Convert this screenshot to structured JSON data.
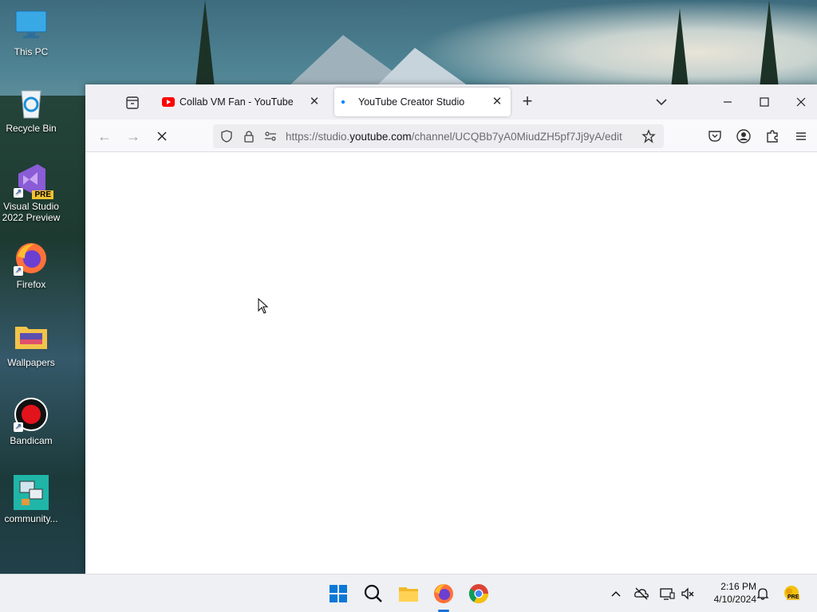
{
  "desktop": {
    "icons": [
      {
        "label": "This PC"
      },
      {
        "label": "Recycle Bin"
      },
      {
        "label": "Visual Studio 2022 Preview",
        "badge": "PRE"
      },
      {
        "label": "Firefox"
      },
      {
        "label": "Wallpapers"
      },
      {
        "label": "Bandicam"
      },
      {
        "label": "community..."
      }
    ]
  },
  "browser": {
    "tabs": [
      {
        "title": "Collab VM Fan - YouTube",
        "active": false,
        "favicon": "youtube-icon"
      },
      {
        "title": "YouTube Creator Studio",
        "active": true,
        "favicon": "loading-dot-icon"
      }
    ],
    "url": {
      "prefix": "https://studio.",
      "domain": "youtube.com",
      "suffix": "/channel/UCQBb7yA0MiudZH5pf7Jj9yA/edit"
    },
    "loading": true
  },
  "taskbar": {
    "apps": [
      "start-icon",
      "search-icon",
      "file-explorer-icon",
      "firefox-icon",
      "chrome-icon"
    ],
    "clock": {
      "time": "2:16 PM",
      "date": "4/10/2024"
    },
    "tray_badge": "PRE"
  },
  "colors": {
    "accent": "#1a73d8",
    "youtube_red": "#ff0000",
    "tab_loading_dot": "#0a84ff"
  }
}
